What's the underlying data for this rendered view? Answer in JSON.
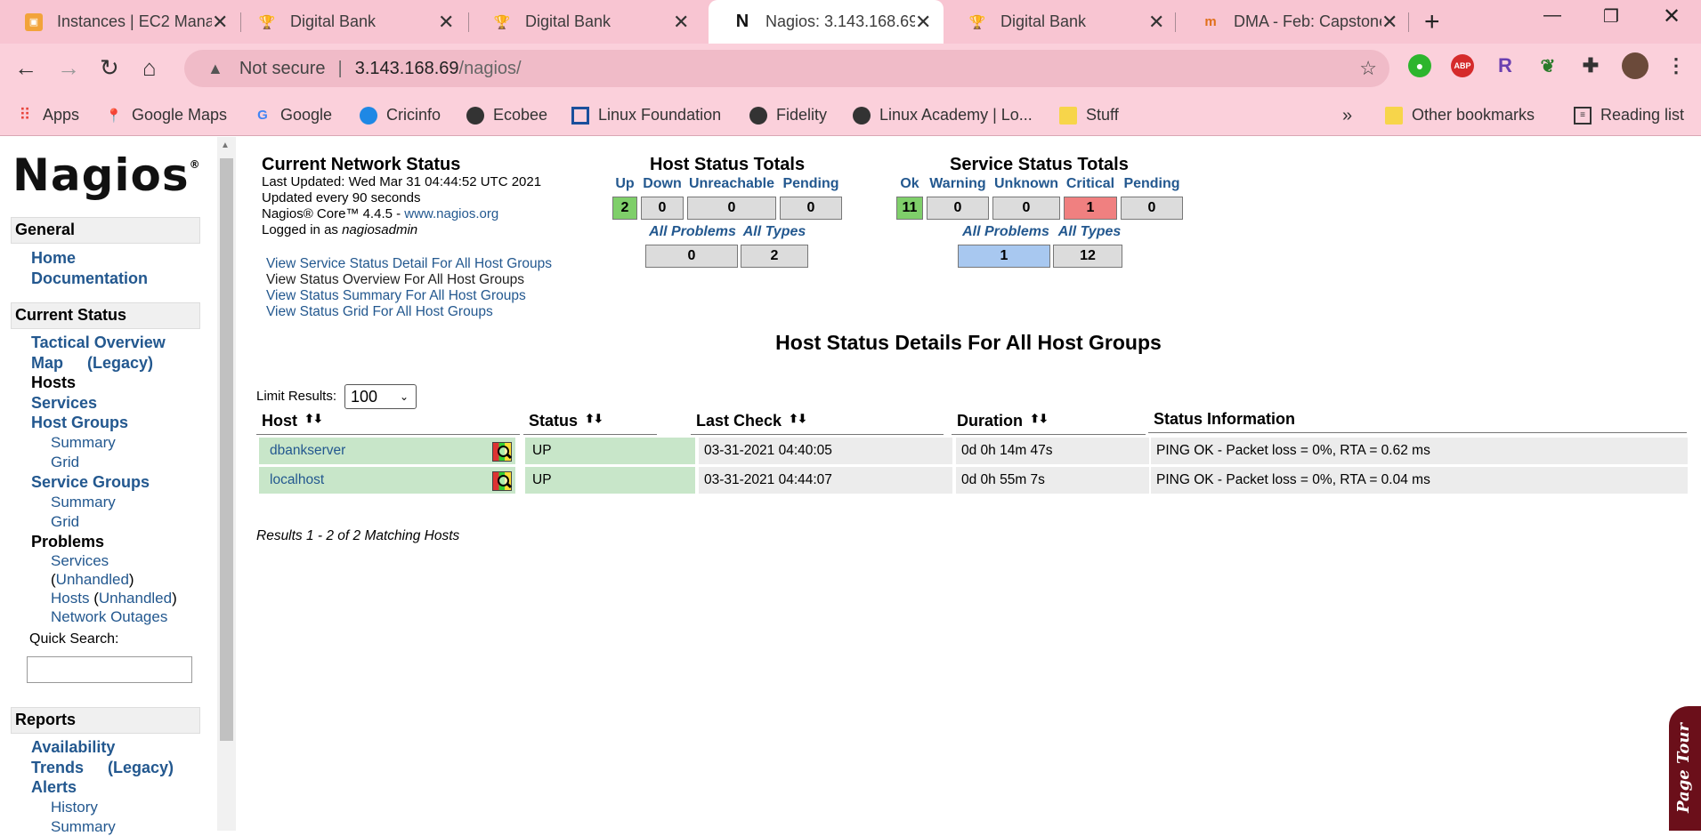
{
  "browser": {
    "tabs": [
      {
        "title": "Instances | EC2 Mana",
        "icon": "aws-box-icon"
      },
      {
        "title": "Digital Bank",
        "icon": "trophy-icon"
      },
      {
        "title": "Digital Bank",
        "icon": "trophy-icon"
      },
      {
        "title": "Nagios: 3.143.168.69",
        "icon": "nagios-n-icon"
      },
      {
        "title": "Digital Bank",
        "icon": "trophy-icon"
      },
      {
        "title": "DMA - Feb: Capstone",
        "icon": "dma-icon"
      }
    ],
    "address": {
      "security": "Not secure",
      "host": "3.143.168.69",
      "path": "/nagios/"
    },
    "bookmarks": [
      {
        "label": "Apps",
        "icon": "apps-grid-icon"
      },
      {
        "label": "Google Maps",
        "icon": "maps-pin-icon"
      },
      {
        "label": "Google",
        "icon": "google-g-icon"
      },
      {
        "label": "Cricinfo",
        "icon": "cricinfo-icon"
      },
      {
        "label": "Ecobee",
        "icon": "globe-icon"
      },
      {
        "label": "Linux Foundation",
        "icon": "linux-foundation-icon"
      },
      {
        "label": "Fidelity",
        "icon": "globe-icon"
      },
      {
        "label": "Linux Academy | Lo...",
        "icon": "globe-icon"
      },
      {
        "label": "Stuff",
        "icon": "folder-icon"
      }
    ],
    "other_bookmarks": "Other bookmarks",
    "reading_list": "Reading list",
    "more_glyph": "»",
    "extensions": [
      "ABP",
      "R"
    ]
  },
  "sidebar": {
    "logo": "Nagios",
    "sections": {
      "general": "General",
      "current_status": "Current Status",
      "reports": "Reports"
    },
    "general_links": {
      "home": "Home",
      "documentation": "Documentation"
    },
    "status_links": {
      "tactical": "Tactical Overview",
      "map": "Map",
      "legacy": "(Legacy)",
      "hosts": "Hosts",
      "services": "Services",
      "host_groups": "Host Groups",
      "hg_summary": "Summary",
      "hg_grid": "Grid",
      "service_groups": "Service Groups",
      "sg_summary": "Summary",
      "sg_grid": "Grid",
      "problems": "Problems",
      "p_services": "Services",
      "p_services_unhandled": "Unhandled",
      "p_hosts": "Hosts",
      "p_hosts_unhandled": "Unhandled",
      "network_outages": "Network Outages"
    },
    "quick_search_label": "Quick Search:",
    "report_links": {
      "availability": "Availability",
      "trends": "Trends",
      "trends_legacy": "(Legacy)",
      "alerts": "Alerts",
      "history": "History",
      "summary": "Summary"
    }
  },
  "status": {
    "title": "Current Network Status",
    "last_updated": "Last Updated: Wed Mar 31 04:44:52 UTC 2021",
    "update_interval": "Updated every 90 seconds",
    "core_version": "Nagios® Core™ 4.4.5 - ",
    "core_link": "www.nagios.org",
    "logged_in_prefix": "Logged in as ",
    "user": "nagiosadmin",
    "view_links": [
      "View Service Status Detail For All Host Groups",
      "View Status Overview For All Host Groups",
      "View Status Summary For All Host Groups",
      "View Status Grid For All Host Groups"
    ]
  },
  "host_totals": {
    "title": "Host Status Totals",
    "headers": [
      "Up",
      "Down",
      "Unreachable",
      "Pending"
    ],
    "values": [
      "2",
      "0",
      "0",
      "0"
    ],
    "sub_headers": [
      "All Problems",
      "All Types"
    ],
    "sub_values": [
      "0",
      "2"
    ]
  },
  "service_totals": {
    "title": "Service Status Totals",
    "headers": [
      "Ok",
      "Warning",
      "Unknown",
      "Critical",
      "Pending"
    ],
    "values": [
      "11",
      "0",
      "0",
      "1",
      "0"
    ],
    "sub_headers": [
      "All Problems",
      "All Types"
    ],
    "sub_values": [
      "1",
      "12"
    ]
  },
  "colors": {
    "ok_green": "#7fcf6a",
    "critical_red": "#f08080",
    "problem_blue": "#a8c8f0",
    "host_row_green": "#c8e6c9",
    "link_blue": "#23588f"
  },
  "details": {
    "title": "Host Status Details For All Host Groups",
    "limit_label": "Limit Results:",
    "limit_value": "100",
    "columns": [
      "Host",
      "Status",
      "Last Check",
      "Duration",
      "Status Information"
    ],
    "rows": [
      {
        "host": "dbankserver",
        "status": "UP",
        "last_check": "03-31-2021 04:40:05",
        "duration": "0d 0h 14m 47s",
        "info": "PING OK - Packet loss = 0%, RTA = 0.62 ms"
      },
      {
        "host": "localhost",
        "status": "UP",
        "last_check": "03-31-2021 04:44:07",
        "duration": "0d 0h 55m 7s",
        "info": "PING OK - Packet loss = 0%, RTA = 0.04 ms"
      }
    ],
    "results": "Results 1 - 2 of 2 Matching Hosts"
  },
  "page_tour": "Page Tour"
}
